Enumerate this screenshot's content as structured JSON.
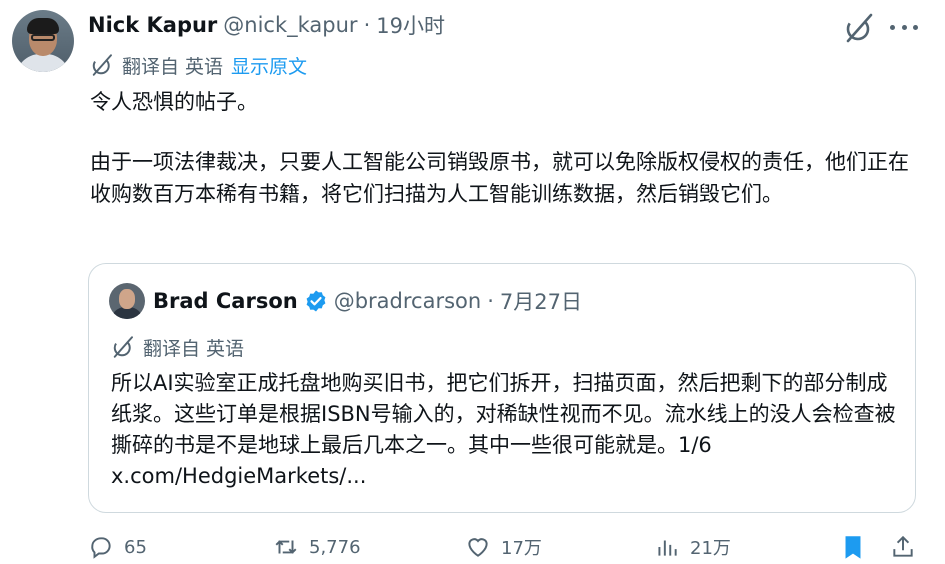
{
  "post": {
    "author_name": "Nick Kapur",
    "author_handle": "@nick_kapur",
    "separator": "·",
    "time": "19小时",
    "translated_from": "翻译自 英语",
    "show_original": "显示原文",
    "text": [
      "令人恐惧的帖子。",
      "由于一项法律裁决，只要人工智能公司销毁原书，就可以免除版权侵权的责任，他们正在收购数百万本稀有书籍，将它们扫描为人工智能训练数据，然后销毁它们。"
    ]
  },
  "quote": {
    "author_name": "Brad Carson",
    "author_handle": "@bradrcarson",
    "separator": "·",
    "time": "7月27日",
    "translated_from": "翻译自 英语",
    "text": "所以AI实验室正成托盘地购买旧书，把它们拆开，扫描页面，然后把剩下的部分制成纸浆。这些订单是根据ISBN号输入的，对稀缺性视而不见。流水线上的没人会检查被撕碎的书是不是地球上最后几本之一。其中一些很可能就是。1/6 x.com/HedgieMarkets/..."
  },
  "actions": {
    "replies": "65",
    "retweets": "5,776",
    "likes": "17万",
    "views": "21万"
  },
  "icons": {
    "grok": "grok-icon",
    "more": "more-dots-icon",
    "translate": "translate-icon",
    "verified": "verified-badge-icon",
    "reply": "reply-icon",
    "retweet": "retweet-icon",
    "like": "heart-icon",
    "views": "views-icon",
    "bookmark": "bookmark-icon",
    "share": "share-icon"
  },
  "colors": {
    "text": "#0f1419",
    "muted": "#536471",
    "accent": "#1d9bf0",
    "border": "#cfd9de"
  }
}
